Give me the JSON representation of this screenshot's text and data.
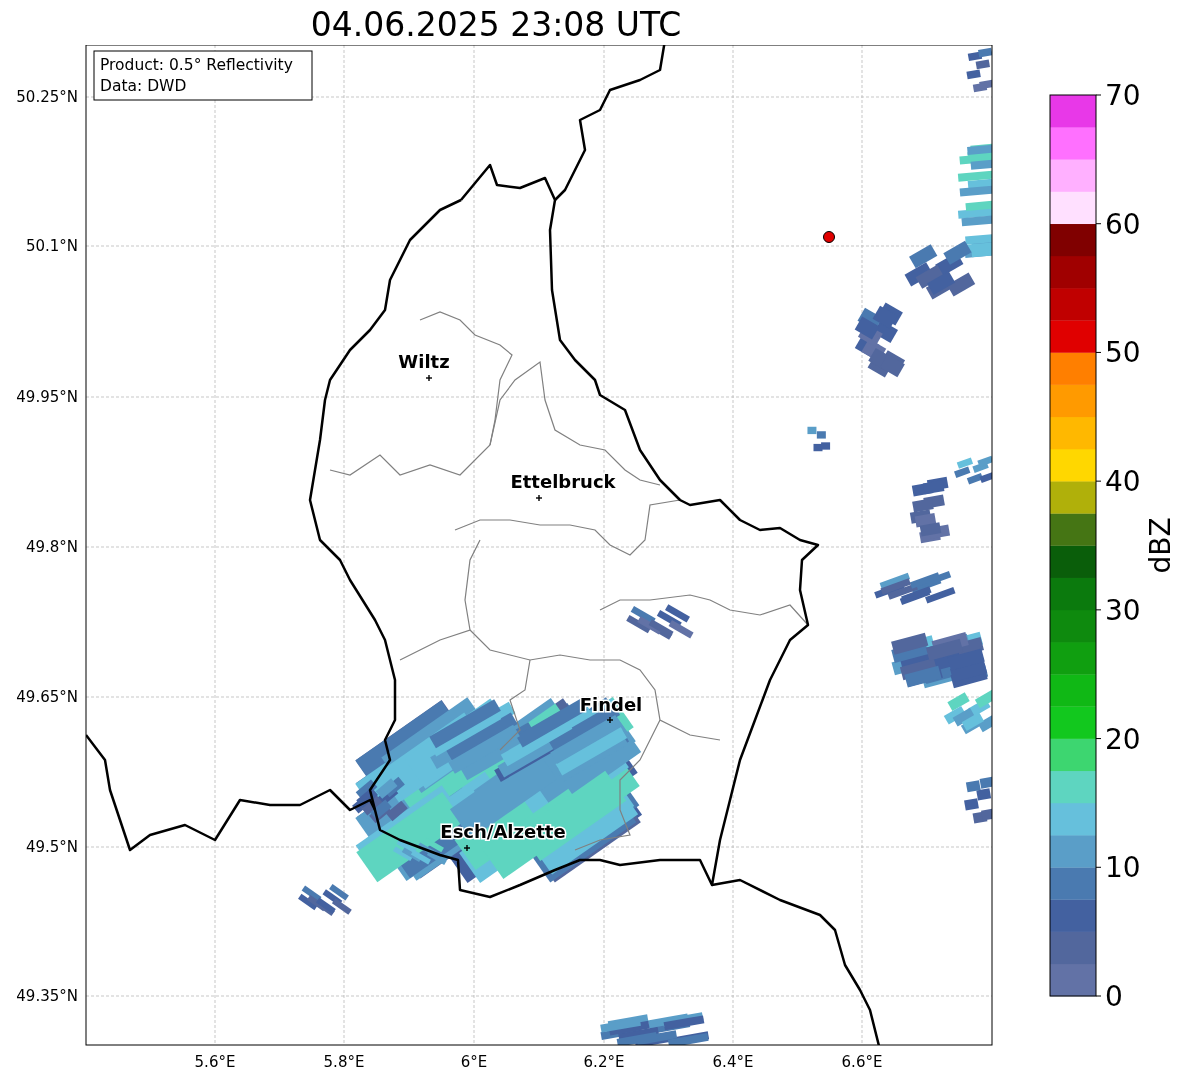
{
  "title": "04.06.2025 23:08 UTC",
  "legend": [
    "Product: 0.5° Reflectivity",
    "Data: DWD"
  ],
  "map": {
    "yticks": [
      "50.25°N",
      "50.1°N",
      "49.95°N",
      "49.8°N",
      "49.65°N",
      "49.5°N",
      "49.35°N"
    ],
    "xticks": [
      "5.6°E",
      "5.8°E",
      "6°E",
      "6.2°E",
      "6.4°E",
      "6.6°E"
    ],
    "cities": [
      {
        "name": "Wiltz"
      },
      {
        "name": "Ettelbruck"
      },
      {
        "name": "Findel"
      },
      {
        "name": "Esch/Alzette"
      }
    ]
  },
  "colorbar": {
    "label": "dBZ",
    "ticks": [
      "70",
      "60",
      "50",
      "40",
      "30",
      "20",
      "10",
      "0"
    ],
    "segments": [
      {
        "color": "#6272a6"
      },
      {
        "color": "#52679d"
      },
      {
        "color": "#4361a0"
      },
      {
        "color": "#4a7ab0"
      },
      {
        "color": "#5a9ec8"
      },
      {
        "color": "#66c0dc"
      },
      {
        "color": "#5ed5c0"
      },
      {
        "color": "#3dd670"
      },
      {
        "color": "#12c81e"
      },
      {
        "color": "#10b815"
      },
      {
        "color": "#109f10"
      },
      {
        "color": "#0e8a0e"
      },
      {
        "color": "#0b7a0d"
      },
      {
        "color": "#0a5e0a"
      },
      {
        "color": "#457514"
      },
      {
        "color": "#b0b00a"
      },
      {
        "color": "#ffd700"
      },
      {
        "color": "#ffb800"
      },
      {
        "color": "#ff9a00"
      },
      {
        "color": "#ff7f00"
      },
      {
        "color": "#e00000"
      },
      {
        "color": "#c00000"
      },
      {
        "color": "#a00000"
      },
      {
        "color": "#800000"
      },
      {
        "color": "#ffe0ff"
      },
      {
        "color": "#ffb0ff"
      },
      {
        "color": "#ff70ff"
      },
      {
        "color": "#e838e8"
      }
    ]
  }
}
